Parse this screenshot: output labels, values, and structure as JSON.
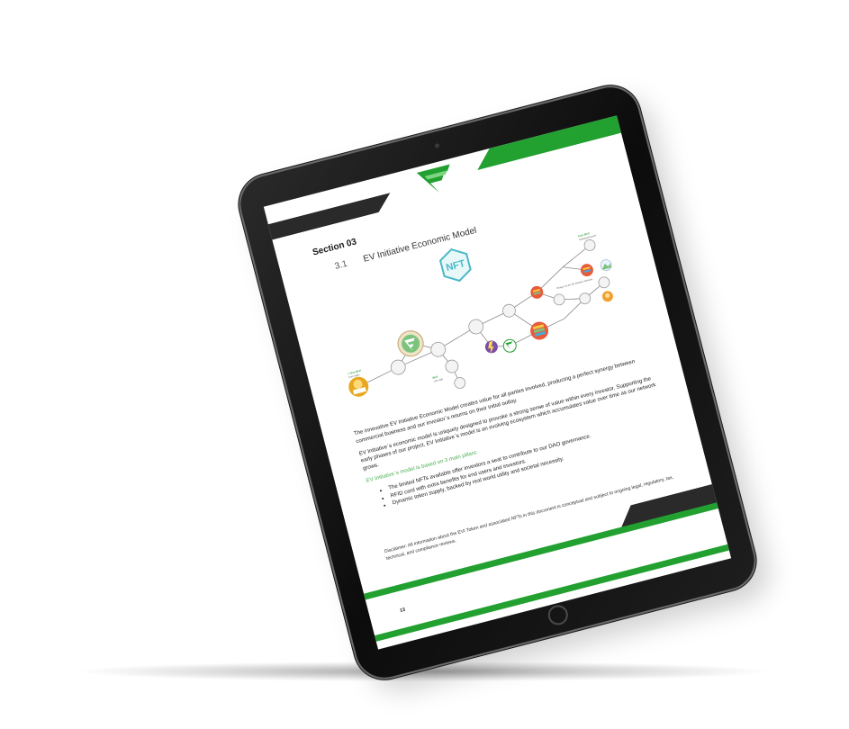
{
  "document": {
    "section_label": "Section 03",
    "heading_number": "3.1",
    "heading_title": "EV Initiative Economic Model",
    "nft_badge_text": "NFT",
    "paragraphs": [
      "The innovative EV Initiative Economic Model creates value for all parties involved, producing a perfect synergy between commercial business and our investor`s returns on their initial outlay.",
      "EV Initiative`s economic model is uniquely designed to provoke a strong sense of value within every investor. Supporting the early phases of our project, EV Initiative`s model is an evolving ecosystem which accumulates value over time as our network grows."
    ],
    "pillars_title": "EV Initiative`s model is based on 3 main pillars:",
    "bullets": [
      "The limited NFTs available offer investors a seat to contribute to our DAO governance.",
      "RFID card with extra benefits for end users and investors.",
      "Dynamic token supply, backed by real world utility and societal necessity."
    ],
    "disclaimer": "Disclaimer: All information about the EVI Token and associated NFTs in this document is conceptual and subject to ongoing legal, regulatory, tax, technical, and compliance reviews.",
    "page_number": "13"
  },
  "diagram_labels": {
    "buy_evi": "1. Buy $EVI",
    "buy_evi_sub": "from wallet",
    "evi_amount": "$EVI",
    "evi_amount_sub": "+5% VoB",
    "earn_evi": "Earn $EVI",
    "earn_evi_sub": "Staking Rewards",
    "charge": "Charge via the EV Initiative Network"
  },
  "colors": {
    "accent_green": "#22a030",
    "band_dark": "#2a2a2a",
    "bezel": "#111111"
  }
}
